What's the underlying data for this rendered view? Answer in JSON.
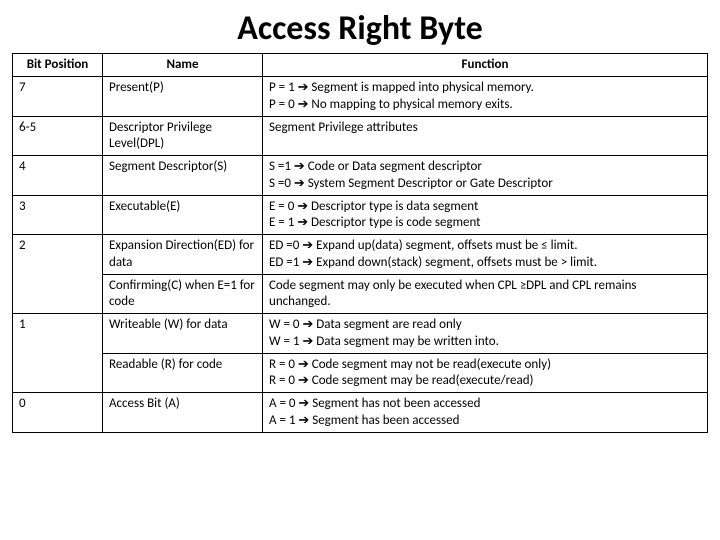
{
  "title": "Access Right Byte",
  "headers": {
    "bit": "Bit Position",
    "name": "Name",
    "func": "Function"
  },
  "rows": [
    {
      "bit": "7",
      "name": "Present(P)",
      "func": "P = 1 ➔ Segment is mapped into physical memory.\nP = 0 ➔ No mapping to physical memory exits."
    },
    {
      "bit": "6-5",
      "name": "Descriptor Privilege Level(DPL)",
      "func": "Segment Privilege attributes"
    },
    {
      "bit": "4",
      "name": "Segment Descriptor(S)",
      "func": "S =1 ➔ Code or Data segment descriptor\nS =0 ➔ System Segment Descriptor or Gate Descriptor"
    },
    {
      "bit": "3",
      "name": "Executable(E)",
      "func": "E = 0 ➔ Descriptor type is data segment\nE = 1 ➔ Descriptor type is code segment"
    },
    {
      "bit": "2",
      "name": "Expansion Direction(ED)  for data",
      "func": "ED =0 ➔ Expand up(data) segment, offsets must be ≤ limit.\nED =1 ➔ Expand down(stack) segment, offsets must be > limit."
    },
    {
      "bit": "",
      "name": "Confirming(C) when E=1 for code",
      "func": "Code segment may only be executed when CPL ≥DPL and CPL remains unchanged."
    },
    {
      "bit": "1",
      "name": "Writeable (W) for data",
      "func": "W = 0 ➔ Data segment are read only\nW = 1 ➔ Data segment may be written into."
    },
    {
      "bit": "",
      "name": "Readable (R) for code",
      "func": "R = 0 ➔ Code segment may not be read(execute only)\nR = 0 ➔ Code segment may be read(execute/read)"
    },
    {
      "bit": "0",
      "name": "Access Bit (A)",
      "func": "A = 0 ➔ Segment has not been accessed\nA = 1 ➔ Segment has been accessed"
    }
  ]
}
